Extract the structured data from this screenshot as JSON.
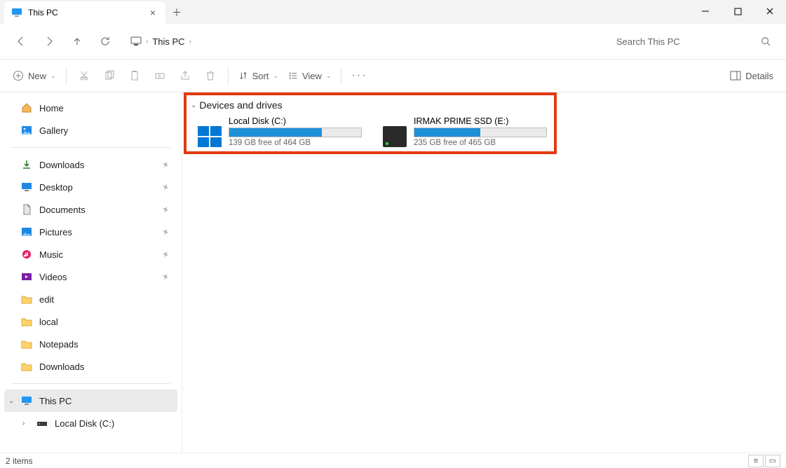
{
  "tab": {
    "title": "This PC"
  },
  "breadcrumb": {
    "current": "This PC"
  },
  "search": {
    "placeholder": "Search This PC"
  },
  "toolbar": {
    "new": "New",
    "sort": "Sort",
    "view": "View",
    "details": "Details"
  },
  "sidebar": {
    "home": "Home",
    "gallery": "Gallery",
    "quick": [
      {
        "label": "Downloads"
      },
      {
        "label": "Desktop"
      },
      {
        "label": "Documents"
      },
      {
        "label": "Pictures"
      },
      {
        "label": "Music"
      },
      {
        "label": "Videos"
      },
      {
        "label": "edit"
      },
      {
        "label": "local"
      },
      {
        "label": "Notepads"
      },
      {
        "label": "Downloads"
      }
    ],
    "thispc": "This PC",
    "localdisk": "Local Disk (C:)"
  },
  "content": {
    "section": "Devices and drives",
    "drives": [
      {
        "name": "Local Disk (C:)",
        "free": "139 GB free of 464 GB",
        "fill_pct": 70
      },
      {
        "name": "IRMAK PRIME SSD (E:)",
        "free": "235 GB free of 465 GB",
        "fill_pct": 50
      }
    ]
  },
  "status": {
    "items": "2 items"
  }
}
